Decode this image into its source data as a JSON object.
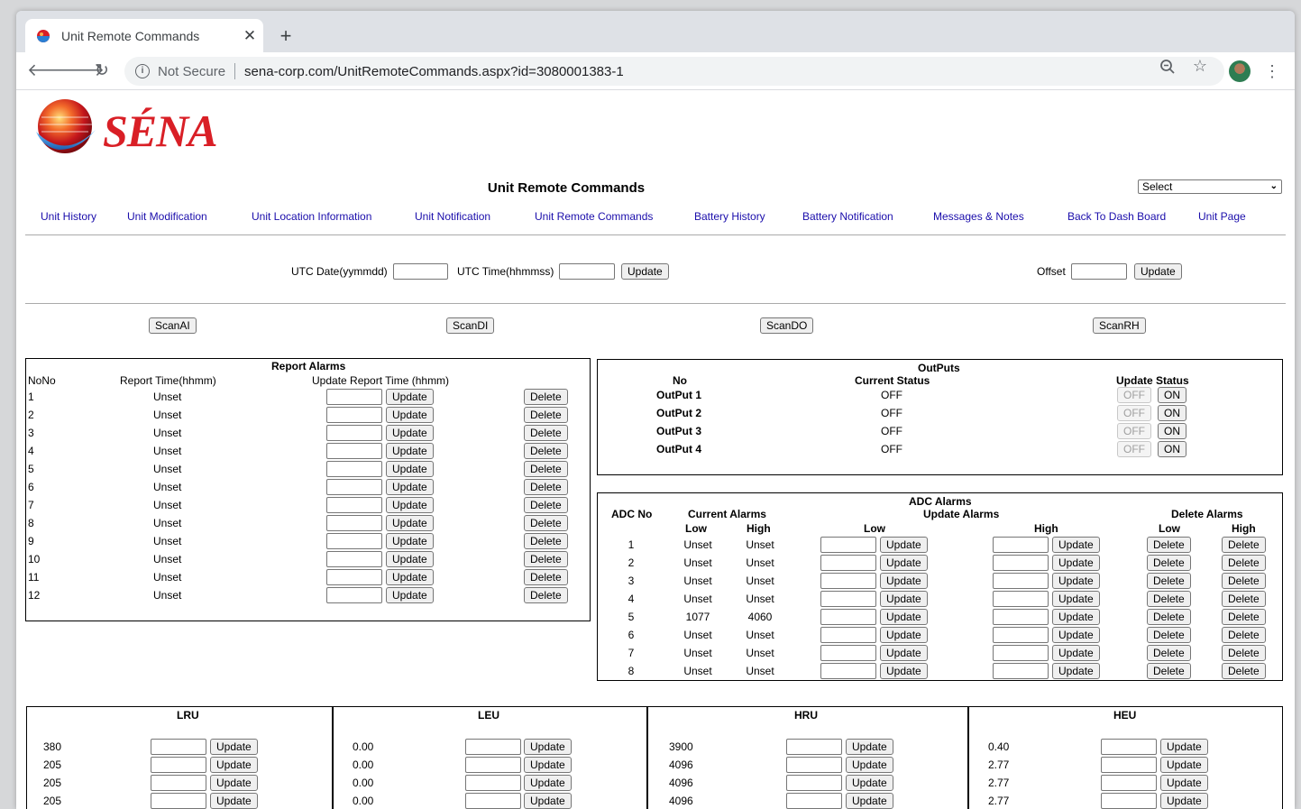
{
  "browser": {
    "tab_title": "Unit Remote Commands",
    "security_label": "Not Secure",
    "url": "sena-corp.com/UnitRemoteCommands.aspx?id=3080001383-1"
  },
  "logo": {
    "text": "SÉNA"
  },
  "page": {
    "title": "Unit Remote Commands",
    "select_value": "Select"
  },
  "nav_links": [
    "Unit History",
    "Unit Modification",
    "Unit Location Information",
    "Unit Notification",
    "Unit Remote Commands",
    "Battery History",
    "Battery Notification",
    "Messages & Notes",
    "Back To Dash Board",
    "Unit Page"
  ],
  "utc": {
    "date_label": "UTC Date(yymmdd)",
    "time_label": "UTC Time(hhmmss)",
    "update_label": "Update",
    "offset_label": "Offset",
    "offset_update_label": "Update"
  },
  "scan_buttons": [
    "ScanAI",
    "ScanDI",
    "ScanDO",
    "ScanRH"
  ],
  "report_alarms": {
    "title": "Report Alarms",
    "col_no": "NoNo",
    "col_time": "Report Time(hhmm)",
    "col_update": "Update Report Time (hhmm)",
    "update_label": "Update",
    "delete_label": "Delete",
    "rows": [
      {
        "no": "1",
        "time": "Unset"
      },
      {
        "no": "2",
        "time": "Unset"
      },
      {
        "no": "3",
        "time": "Unset"
      },
      {
        "no": "4",
        "time": "Unset"
      },
      {
        "no": "5",
        "time": "Unset"
      },
      {
        "no": "6",
        "time": "Unset"
      },
      {
        "no": "7",
        "time": "Unset"
      },
      {
        "no": "8",
        "time": "Unset"
      },
      {
        "no": "9",
        "time": "Unset"
      },
      {
        "no": "10",
        "time": "Unset"
      },
      {
        "no": "11",
        "time": "Unset"
      },
      {
        "no": "12",
        "time": "Unset"
      }
    ]
  },
  "outputs": {
    "title": "OutPuts",
    "col_no": "No",
    "col_status": "Current Status",
    "col_update": "Update Status",
    "off_label": "OFF",
    "on_label": "ON",
    "rows": [
      {
        "name": "OutPut 1",
        "status": "OFF"
      },
      {
        "name": "OutPut 2",
        "status": "OFF"
      },
      {
        "name": "OutPut 3",
        "status": "OFF"
      },
      {
        "name": "OutPut 4",
        "status": "OFF"
      }
    ]
  },
  "adc_alarms": {
    "title": "ADC Alarms",
    "col_no": "ADC No",
    "current_alarms": "Current Alarms",
    "update_alarms": "Update Alarms",
    "delete_alarms": "Delete Alarms",
    "low": "Low",
    "high": "High",
    "update_label": "Update",
    "delete_label": "Delete",
    "rows": [
      {
        "no": "1",
        "low": "Unset",
        "high": "Unset"
      },
      {
        "no": "2",
        "low": "Unset",
        "high": "Unset"
      },
      {
        "no": "3",
        "low": "Unset",
        "high": "Unset"
      },
      {
        "no": "4",
        "low": "Unset",
        "high": "Unset"
      },
      {
        "no": "5",
        "low": "1077",
        "high": "4060"
      },
      {
        "no": "6",
        "low": "Unset",
        "high": "Unset"
      },
      {
        "no": "7",
        "low": "Unset",
        "high": "Unset"
      },
      {
        "no": "8",
        "low": "Unset",
        "high": "Unset"
      }
    ]
  },
  "bottom_panels": [
    {
      "title": "LRU",
      "values": [
        "380",
        "205",
        "205",
        "205"
      ]
    },
    {
      "title": "LEU",
      "values": [
        "0.00",
        "0.00",
        "0.00",
        "0.00"
      ]
    },
    {
      "title": "HRU",
      "values": [
        "3900",
        "4096",
        "4096",
        "4096"
      ]
    },
    {
      "title": "HEU",
      "values": [
        "0.40",
        "2.77",
        "2.77",
        "2.77"
      ]
    }
  ],
  "bottom_update_label": "Update"
}
